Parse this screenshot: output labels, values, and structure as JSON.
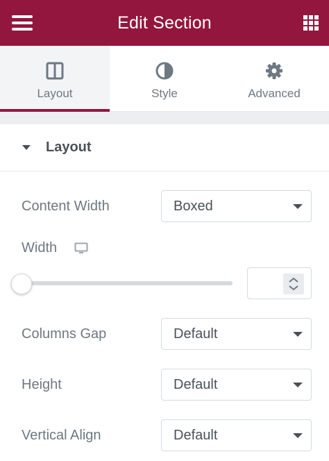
{
  "header": {
    "title": "Edit Section",
    "menu_icon": "hamburger-icon",
    "grid_icon": "grid-icon",
    "background_color": "#93163e"
  },
  "tabs": [
    {
      "label": "Layout",
      "icon": "columns-icon",
      "active": true
    },
    {
      "label": "Style",
      "icon": "half-circle-icon",
      "active": false
    },
    {
      "label": "Advanced",
      "icon": "gear-icon",
      "active": false
    }
  ],
  "section": {
    "title": "Layout",
    "expanded": true
  },
  "controls": {
    "content_width": {
      "label": "Content Width",
      "value": "Boxed"
    },
    "width": {
      "label": "Width",
      "device_icon": "desktop-icon",
      "slider_value": 0,
      "input_value": ""
    },
    "columns_gap": {
      "label": "Columns Gap",
      "value": "Default"
    },
    "height": {
      "label": "Height",
      "value": "Default"
    },
    "vertical_align": {
      "label": "Vertical Align",
      "value": "Default"
    }
  },
  "colors": {
    "accent": "#93163e",
    "text": "#6d7882",
    "border": "#d5dadf"
  }
}
